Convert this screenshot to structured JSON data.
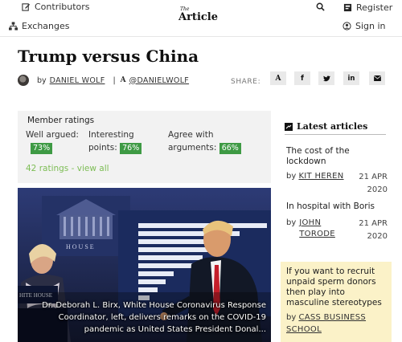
{
  "header": {
    "contributors": "Contributors",
    "exchanges": "Exchanges",
    "logo_small": "The",
    "logo": "Article",
    "register": "Register",
    "sign_in": "Sign in"
  },
  "article": {
    "title": "Trump versus China",
    "by": "by",
    "author": "DANIEL WOLF",
    "sep": "|",
    "handle_mark": "A",
    "handle": "@DANIELWOLF",
    "share_label": "SHARE:",
    "share_icons": [
      "article-icon",
      "facebook-icon",
      "twitter-icon",
      "linkedin-icon",
      "email-icon"
    ]
  },
  "ratings": {
    "heading": "Member ratings",
    "items": [
      {
        "label": "Well argued:",
        "value": "73%"
      },
      {
        "label_line1": "Interesting",
        "label_line2": "points:",
        "value": "76%"
      },
      {
        "label_line1": "Agree with",
        "label_line2": "arguments:",
        "value": "66%"
      }
    ],
    "link": "42 ratings - view all",
    "badge_color": "#3e9a44"
  },
  "photo": {
    "caption": "Dr. Deborah L. Birx, White House Coronavirus Response Coordinator, left, delivers remarks on the COVID-19 pandemic as United States President Donal..."
  },
  "sidebar": {
    "heading": "Latest articles",
    "articles": [
      {
        "title": "The cost of the lockdown",
        "by": "by",
        "author": "KIT HEREN",
        "date_line1": "21 APR",
        "date_line2": "2020"
      },
      {
        "title": "In hospital with Boris",
        "by": "by",
        "author_line1": "JOHN",
        "author_line2": "TORODE",
        "date_line1": "21 APR",
        "date_line2": "2020"
      }
    ],
    "promo": {
      "title": "If you want to recruit unpaid sperm donors then play into masculine stereotypes",
      "by": "by",
      "author": "CASS BUSINESS SCHOOL"
    }
  }
}
